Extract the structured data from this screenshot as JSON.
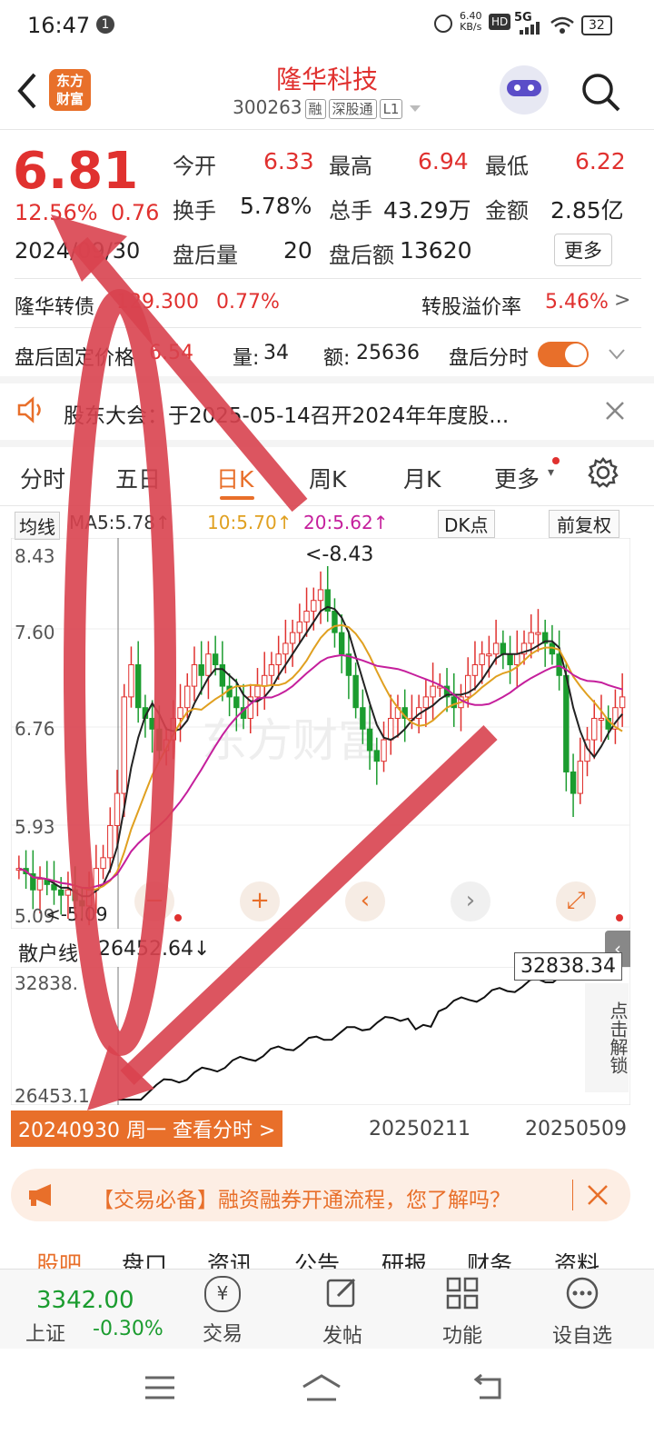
{
  "status": {
    "time": "16:47",
    "notif": "1",
    "speed": "6.40",
    "speed_unit": "KB/s",
    "hd": "HD",
    "net": "5G",
    "battery": "32"
  },
  "header": {
    "logo_line1": "东方",
    "logo_line2": "财富",
    "title": "隆华科技",
    "code": "300263",
    "tags": [
      "融",
      "深股通",
      "L1"
    ]
  },
  "quote": {
    "price": "6.81",
    "pct": "12.56%",
    "chg": "0.76",
    "date": "2024/09/30",
    "open_label": "今开",
    "open": "6.33",
    "high_label": "最高",
    "high": "6.94",
    "low_label": "最低",
    "low": "6.22",
    "turnover_label": "换手",
    "turnover": "5.78%",
    "volume_label": "总手",
    "volume": "43.29万",
    "amount_label": "金额",
    "amount": "2.85亿",
    "ah_vol_label": "盘后量",
    "ah_vol": "20",
    "ah_amt_label": "盘后额",
    "ah_amt": "13620",
    "more": "更多"
  },
  "bond": {
    "name": "隆华转债",
    "price": "129.300",
    "pct": "0.77%",
    "premium_label": "转股溢价率",
    "premium": "5.46%"
  },
  "afterhours": {
    "label": "盘后固定价格",
    "price": "6.54",
    "vol_label": "量:",
    "vol": "34",
    "amt_label": "额:",
    "amt": "25636",
    "toggle_label": "盘后分时"
  },
  "notice": {
    "text": "股东大会：于2025-05-14召开2024年年度股..."
  },
  "tabs": [
    "分时",
    "五日",
    "日K",
    "周K",
    "月K",
    "更多"
  ],
  "ma": {
    "label": "均线",
    "ma5": "MA5:5.78↑",
    "ma10": "10:5.70↑",
    "ma20": "20:5.62↑",
    "dk": "DK点",
    "adj": "前复权"
  },
  "chart_labels": {
    "y1": "8.43",
    "y2": "7.60",
    "y3": "6.76",
    "y4": "5.93",
    "y5": "5.09",
    "peak": "<-8.43",
    "low": "<-5.09"
  },
  "indicator": {
    "label": "散户线",
    "value": "26452.64↓",
    "top": "32838.",
    "bottom": "26453.1",
    "top_value": "32838.34",
    "unlock": "点击解锁"
  },
  "xaxis": {
    "selected": "20240930 周一 查看分时 >",
    "d2": "20250211",
    "d3": "20250509"
  },
  "banner": {
    "text": "【交易必备】融资融券开通流程，您了解吗？"
  },
  "news_tabs": [
    "股吧",
    "盘口",
    "资讯",
    "公告",
    "研报",
    "财务",
    "资料"
  ],
  "bottom": {
    "index_value": "3342.00",
    "index_name": "上证",
    "index_pct": "-0.30%",
    "trade": "交易",
    "post": "发帖",
    "func": "功能",
    "watch": "设自选"
  },
  "colors": {
    "up": "#e0312f",
    "down": "#1b9c2f",
    "accent": "#e86f2a"
  },
  "chart_data": {
    "type": "candlestick",
    "title": "",
    "y_ticks": [
      8.43,
      7.6,
      6.76,
      5.93,
      5.09
    ],
    "ylim": [
      5.09,
      8.43
    ],
    "x_ticks": [
      "20240930",
      "20250211",
      "20250509"
    ],
    "close_series": [
      5.5,
      5.45,
      5.3,
      5.4,
      5.35,
      5.3,
      5.25,
      5.3,
      5.2,
      5.15,
      5.3,
      5.5,
      5.6,
      5.9,
      6.2,
      7.1,
      7.4,
      7.0,
      6.9,
      6.8,
      6.6,
      6.7,
      6.9,
      7.0,
      7.2,
      7.4,
      7.3,
      7.5,
      7.4,
      7.2,
      7.1,
      7.0,
      6.9,
      7.1,
      7.2,
      7.3,
      7.4,
      7.5,
      7.6,
      7.7,
      7.8,
      7.9,
      8.0,
      8.1,
      7.9,
      7.7,
      7.5,
      7.3,
      7.0,
      6.8,
      6.6,
      6.5,
      6.7,
      6.9,
      7.0,
      6.9,
      6.9,
      7.0,
      7.1,
      7.2,
      7.2,
      7.1,
      7.0,
      7.1,
      7.3,
      7.4,
      7.5,
      7.5,
      7.6,
      7.5,
      7.4,
      7.5,
      7.6,
      7.7,
      7.7,
      7.6,
      7.5,
      7.3,
      6.4,
      6.2,
      6.5,
      6.7,
      6.9,
      6.9,
      6.8,
      7.0,
      7.1
    ],
    "ma_series": [
      {
        "name": "MA5",
        "value": 5.78
      },
      {
        "name": "10",
        "value": 5.7
      },
      {
        "name": "20",
        "value": 5.62
      }
    ],
    "indicator": {
      "name": "散户线",
      "start": 26453.1,
      "end": 32838.34
    }
  }
}
